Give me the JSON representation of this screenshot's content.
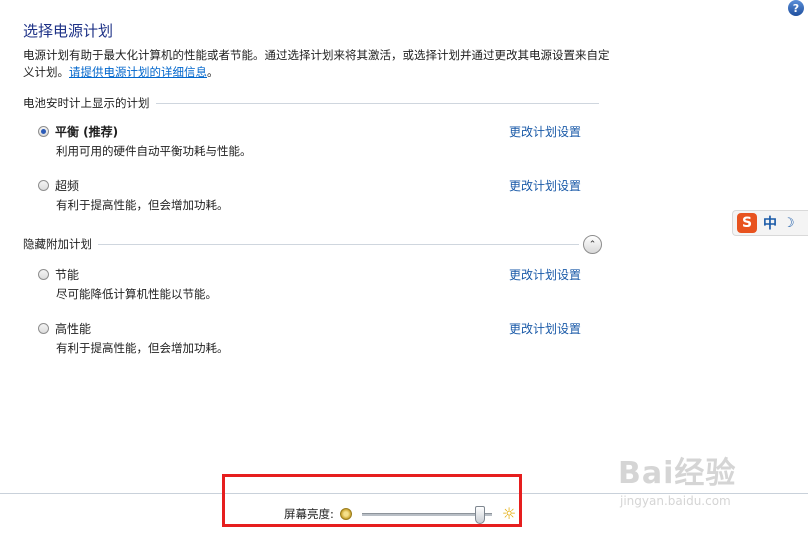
{
  "header": {
    "title": "选择电源计划",
    "intro_text": "电源计划有助于最大化计算机的性能或者节能。通过选择计划来将其激活，或选择计划并通过更改其电源设置来自定义计划。",
    "intro_link": "请提供电源计划的详细信息",
    "intro_end": "。"
  },
  "groups": {
    "battery_meter": "电池安时计上显示的计划",
    "hidden": "隐藏附加计划"
  },
  "plans": [
    {
      "name": "平衡 (推荐)",
      "description": "利用可用的硬件自动平衡功耗与性能。",
      "change_label": "更改计划设置",
      "selected": true
    },
    {
      "name": "超频",
      "description": "有利于提高性能，但会增加功耗。",
      "change_label": "更改计划设置",
      "selected": false
    },
    {
      "name": "节能",
      "description": "尽可能降低计算机性能以节能。",
      "change_label": "更改计划设置",
      "selected": false
    },
    {
      "name": "高性能",
      "description": "有利于提高性能，但会增加功耗。",
      "change_label": "更改计划设置",
      "selected": false
    }
  ],
  "help": {
    "label": "?"
  },
  "ime": {
    "logo": "S",
    "mode": "中",
    "moon": "☽"
  },
  "collapse": {
    "glyph": "⌃"
  },
  "brightness": {
    "label": "屏幕亮度:",
    "value_percent": 94,
    "sun_big": "☼"
  },
  "watermark": {
    "main": "Bai经验",
    "sub": "jingyan.baidu.com"
  },
  "colors": {
    "title": "#1e3287",
    "link": "#1a5aa8",
    "highlight": "#e61e1e"
  }
}
